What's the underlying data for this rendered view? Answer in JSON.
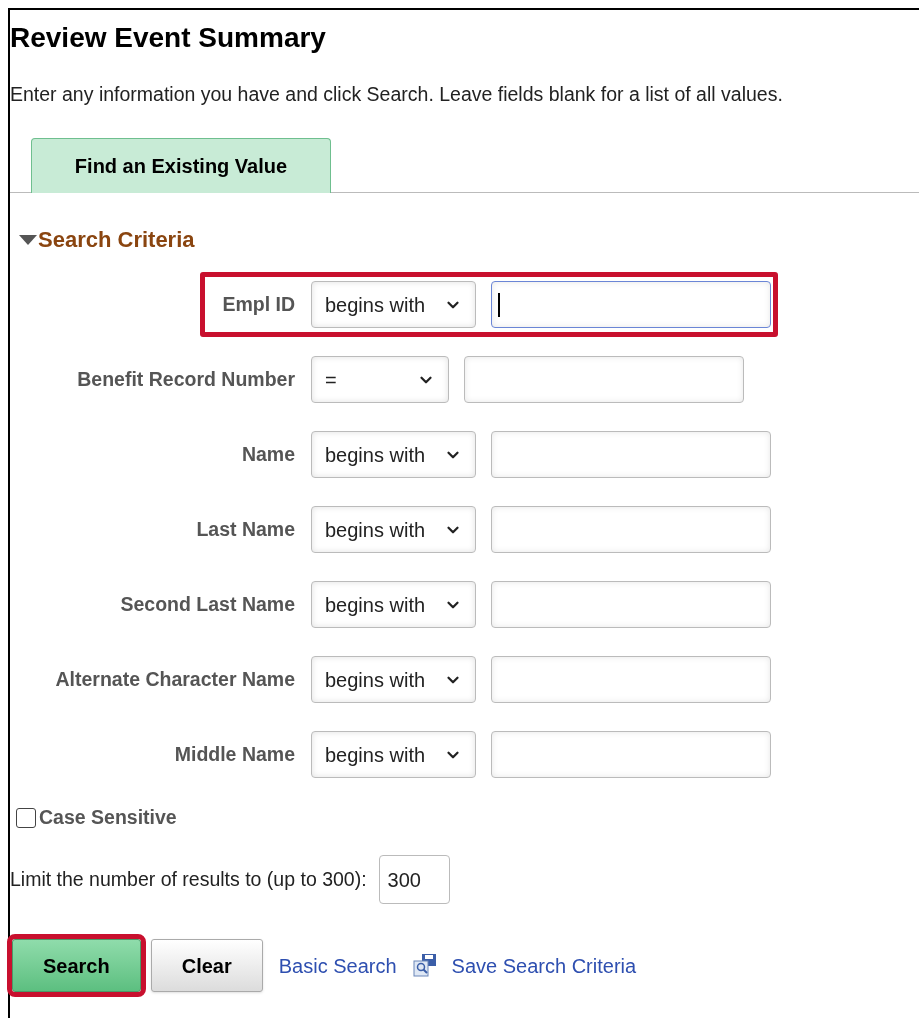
{
  "page": {
    "title": "Review Event Summary",
    "instructions": "Enter any information you have and click Search. Leave fields blank for a list of all values."
  },
  "tabs": [
    {
      "label": "Find an Existing Value",
      "selected": true
    }
  ],
  "section": {
    "title": "Search Criteria",
    "expanded": true
  },
  "criteria": [
    {
      "label": "Empl ID",
      "operator": "begins with",
      "focused": true,
      "highlighted": true
    },
    {
      "label": "Benefit Record Number",
      "operator": "=",
      "focused": false,
      "highlighted": false
    },
    {
      "label": "Name",
      "operator": "begins with",
      "focused": false,
      "highlighted": false
    },
    {
      "label": "Last Name",
      "operator": "begins with",
      "focused": false,
      "highlighted": false
    },
    {
      "label": "Second Last Name",
      "operator": "begins with",
      "focused": false,
      "highlighted": false
    },
    {
      "label": "Alternate Character Name",
      "operator": "begins with",
      "focused": false,
      "highlighted": false
    },
    {
      "label": "Middle Name",
      "operator": "begins with",
      "focused": false,
      "highlighted": false
    }
  ],
  "case_sensitive": {
    "label": "Case Sensitive",
    "checked": false
  },
  "limit": {
    "label": "Limit the number of results to (up to 300):",
    "value": "300"
  },
  "buttons": [
    {
      "label": "Search",
      "kind": "primary",
      "highlighted": true
    },
    {
      "label": "Clear",
      "kind": "secondary",
      "highlighted": false
    }
  ],
  "links": [
    {
      "label": "Basic Search",
      "kind": "text"
    },
    {
      "label": "Save Search Criteria",
      "kind": "icon"
    }
  ]
}
